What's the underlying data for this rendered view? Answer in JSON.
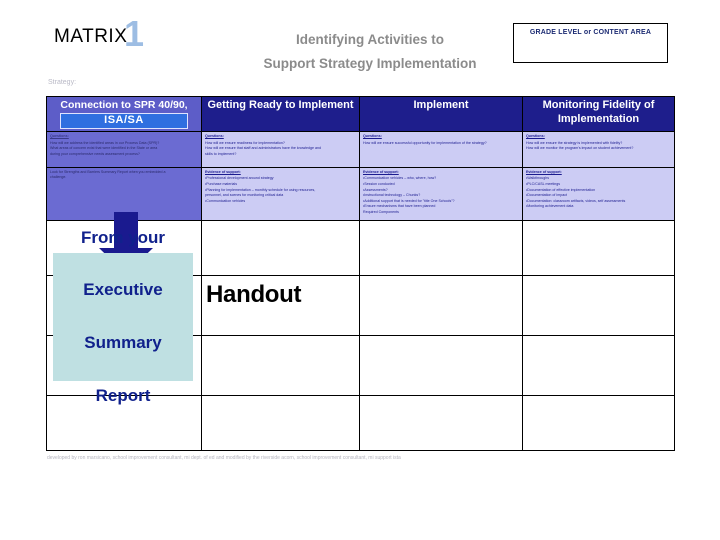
{
  "slide": {
    "matrix_word": "MATRIX",
    "matrix_number": "1",
    "title_line1": "Identifying Activities to",
    "title_line2": "Support Strategy Implementation",
    "grade_box_label": "GRADE LEVEL or CONTENT AREA",
    "strategy_label": "Strategy:"
  },
  "matrix": {
    "headers": [
      {
        "line1": "Connection to SPR 40/90,",
        "chip": "ISA/SA"
      },
      {
        "line1": "Getting Ready to Implement",
        "chip": ""
      },
      {
        "line1": "Implement",
        "chip": ""
      },
      {
        "line1": "Monitoring Fidelity of",
        "line2": "Implementation",
        "chip": ""
      }
    ],
    "questions_row": [
      {
        "heading": "Questions:",
        "lines": [
          "How will we address the identified areas in our Process Data (SPR)?",
          "What areas of concern exist that were identified in the State or area",
          "during your comprehensive needs assessment process?"
        ]
      },
      {
        "heading": "Questions:",
        "lines": [
          "How will we ensure readiness for implementation?",
          "How will we ensure that staff and administrators have the knowledge and",
          "skills to implement?"
        ]
      },
      {
        "heading": "Questions:",
        "lines": [
          "How will we ensure successful opportunity for implementation of the strategy?"
        ]
      },
      {
        "heading": "Questions:",
        "lines": [
          "How will we ensure the strategy is implemented with fidelity?",
          "How will we monitor the program's impact on student achievement?"
        ]
      }
    ],
    "evidence_row": [
      {
        "heading": "",
        "lines": [
          "Look for Strengths and Barriers Summary Report when you embedded a",
          "challenge."
        ]
      },
      {
        "heading": "Evidence of support:",
        "lines": [
          "•Professional development around strategy",
          "•Purchase materials",
          "•Planning for implementation – monthly schedule for using resources,",
          "personnel, and scenes for monitoring critical data",
          "•Communication vehicles"
        ]
      },
      {
        "heading": "Evidence of support:",
        "lines": [
          "•Communication vehicles – who, where, how?",
          "•Session conducted",
          "•Assessments?",
          "•Instructional technology – Chunks?",
          "•Additional support that is needed for \"title One Schools\"?",
          "•Ensure mechanisms that have been planned",
          "",
          "Required Components"
        ]
      },
      {
        "heading": "Evidence of support:",
        "lines": [
          "•Walkthroughs",
          "•PLC/CASL meetings",
          "•Documentation of effective implementation",
          "•Documentation of impact",
          "•Documentation: classroom artifacts, videos, self assessments",
          "•Monitoring achievement data"
        ]
      }
    ]
  },
  "overlays": {
    "arrow_name": "down-arrow",
    "callout_lines": [
      "From your",
      "Executive",
      "Summary",
      "Report"
    ],
    "handout_label": "Handout"
  },
  "footer": {
    "credit": "developed by ron marsicano, school improvement consultant, mi dept. of ed and modified by the riverside acorn, school improvement consultant, mi support ista"
  },
  "colors": {
    "header_navy": "#1e1e8c",
    "header_periwinkle": "#5d5dc8",
    "cell_lavender": "#ccccf4",
    "callout_teal": "#bfe0e2",
    "callout_text": "#10218c",
    "title_gray": "#8b8b8b",
    "matrix_number_blue": "#9dbde3"
  }
}
